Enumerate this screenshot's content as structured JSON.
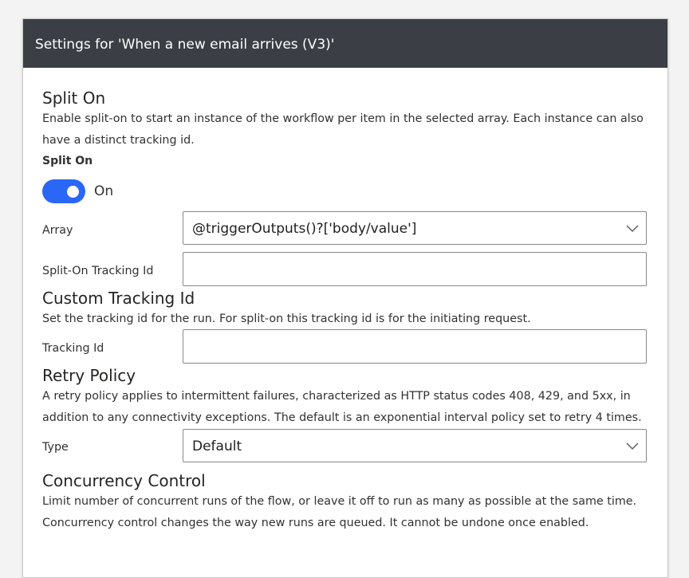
{
  "header": {
    "title": "Settings for 'When a new email arrives (V3)'"
  },
  "split_on": {
    "title": "Split On",
    "description_line1": "Enable split-on to start an instance of the workflow per item in the selected array. Each instance can also",
    "description_line2": "have a distinct tracking id.",
    "toggle_label": "Split On",
    "toggle_state": "On",
    "array_label": "Array",
    "array_value": "@triggerOutputs()?['body/value']",
    "tracking_label": "Split-On Tracking Id",
    "tracking_value": ""
  },
  "custom_tracking": {
    "title": "Custom Tracking Id",
    "description": "Set the tracking id for the run. For split-on this tracking id is for the initiating request.",
    "tracking_label": "Tracking Id",
    "tracking_value": ""
  },
  "retry_policy": {
    "title": "Retry Policy",
    "description_line1": "A retry policy applies to intermittent failures, characterized as HTTP status codes 408, 429, and 5xx, in",
    "description_line2": "addition to any connectivity exceptions. The default is an exponential interval policy set to retry 4 times.",
    "type_label": "Type",
    "type_value": "Default"
  },
  "concurrency": {
    "title": "Concurrency Control",
    "description_line1": "Limit number of concurrent runs of the flow, or leave it off to run as many as possible at the same time.",
    "description_line2": "Concurrency control changes the way new runs are queued. It cannot be undone once enabled."
  },
  "colors": {
    "header_bg": "#3b3f45",
    "toggle_on": "#2b67f6"
  },
  "icons": {
    "dropdown": "chevron-down-icon"
  }
}
